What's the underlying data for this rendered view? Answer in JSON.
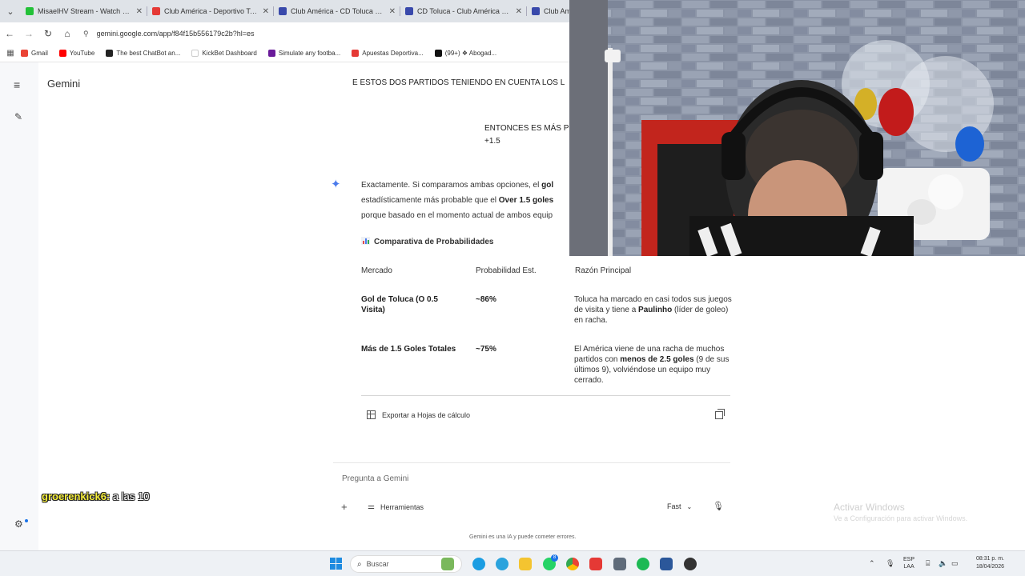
{
  "tabs": [
    {
      "label": "MisaelHV Stream - Watch Live ...",
      "color": "#23c138"
    },
    {
      "label": "Club América - Deportivo Tolu...",
      "color": "#e53935"
    },
    {
      "label": "Club América - CD Toluca en v...",
      "color": "#3949ab"
    },
    {
      "label": "CD Toluca - Club América en v...",
      "color": "#3949ab"
    },
    {
      "label": "Club Am",
      "color": "#3949ab"
    }
  ],
  "address": {
    "url": "gemini.google.com/app/f84f15b556179c2b?hl=es"
  },
  "bookmarks": [
    {
      "label": "Gmail",
      "color": "#ea4335"
    },
    {
      "label": "YouTube",
      "color": "#ff0000"
    },
    {
      "label": "The best ChatBot an...",
      "color": "#222222"
    },
    {
      "label": "KickBet Dashboard",
      "color": "#ffffff"
    },
    {
      "label": "Simulate any footba...",
      "color": "#6a1b9a"
    },
    {
      "label": "Apuestas Deportiva...",
      "color": "#e53935"
    },
    {
      "label": "(99+) ❖ Abogad...",
      "color": "#111111"
    }
  ],
  "gemini": {
    "brand": "Gemini",
    "user_q1": "E ESTOS DOS PARTIDOS TENIENDO EN CUENTA LOS L",
    "user_q2_line1": "ENTONCES ES MÁS P",
    "user_q2_line2": "+1.5",
    "answer": {
      "l1_a": "Exactamente. Si comparamos ambas opciones, el ",
      "l1_b": "gol",
      "l2_a": "estadísticamente más probable que el ",
      "l2_b": "Over 1.5 goles",
      "l3": "porque basado en el momento actual de ambos equip"
    },
    "comparison_title": "Comparativa de Probabilidades",
    "table": {
      "headers": [
        "Mercado",
        "Probabilidad Est.",
        "Razón Principal"
      ],
      "rows": [
        {
          "market": "Gol de Toluca (O 0.5 Visita)",
          "prob": "~86%",
          "reason_a": "Toluca ha marcado en casi todos sus juegos de visita y tiene a ",
          "reason_b": "Paulinho",
          "reason_c": " (líder de goleo) en racha."
        },
        {
          "market": "Más de 1.5 Goles Totales",
          "prob": "~75%",
          "reason_a": "El América viene de una racha de muchos partidos con ",
          "reason_b": "menos de 2.5 goles",
          "reason_c": " (9 de sus últimos 9), volviéndose un equipo muy cerrado."
        }
      ]
    },
    "export_label": "Exportar a Hojas de cálculo",
    "input_placeholder": "Pregunta a Gemini",
    "tools_label": "Herramientas",
    "mode_label": "Fast",
    "disclaimer": "Gemini es una IA y puede cometer errores."
  },
  "overlay": {
    "user": "groerenkick6:",
    "message": "a las 10"
  },
  "watermark": {
    "title": "Activar Windows",
    "subtitle": "Ve a Configuración para activar Windows."
  },
  "taskbar": {
    "search_placeholder": "Buscar",
    "lang_line1": "ESP",
    "lang_line2": "LAA",
    "time": "08:31 p. m.",
    "date": "18/04/2026",
    "badge_count": "8"
  },
  "colors": {
    "accent": "#1a73e8",
    "spark": "#4b7bec",
    "overlay_name": "#f6ee3a"
  }
}
